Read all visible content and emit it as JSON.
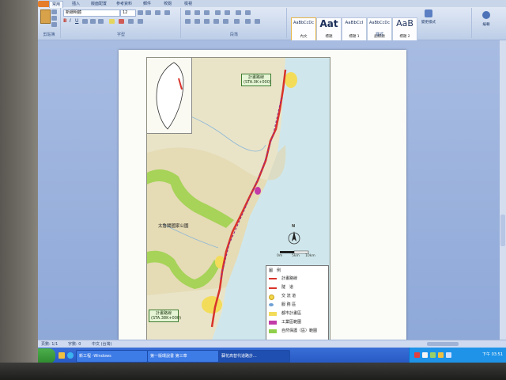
{
  "ribbon": {
    "tabs": [
      "常用",
      "插入",
      "版面配置",
      "參考資料",
      "郵件",
      "校閱",
      "檢視"
    ],
    "font_name": "新細明體",
    "font_size": "12",
    "groups": [
      "剪貼簿",
      "字型",
      "段落",
      "樣式"
    ],
    "styles": [
      {
        "sample": "AaBbCcDc",
        "name": "內文"
      },
      {
        "sample": "Aat",
        "name": "標題"
      },
      {
        "sample": "AaBbCcI",
        "name": "標題 1"
      },
      {
        "sample": "AaBbCcDc",
        "name": "副標題"
      },
      {
        "sample": "AaB",
        "name": "標題 2"
      }
    ],
    "change_styles_label": "變更樣式",
    "edit_label": "編輯"
  },
  "map": {
    "plan_label_top": "計畫路線",
    "plan_sub_top": "(STA.0K+000)",
    "plan_label_bottom": "計畫路線",
    "plan_sub_bottom": "(STA.38K+000)",
    "park_label": "太魯閣國家公園",
    "north_label": "N",
    "scale_labels": [
      "0m",
      "5km",
      "10km"
    ],
    "legend_title": "圖　例",
    "legend_items": [
      {
        "label": "計畫路線",
        "color": "#d9332b"
      },
      {
        "label": "隧　道",
        "color": "#d9332b"
      },
      {
        "label": "交 流 道",
        "color": "#f2d64b"
      },
      {
        "label": "服 務 區",
        "color": "#6ea0d6"
      },
      {
        "label": "都市計畫區",
        "color": "#f3dc5a"
      },
      {
        "label": "工業區範圍",
        "color": "#c23ba8"
      },
      {
        "label": "自然保護（區）範圍",
        "color": "#8fcf4a"
      }
    ]
  },
  "statusbar": {
    "page": "頁數: 1/1",
    "words": "字數: 0",
    "lang": "中文 (台灣)"
  },
  "taskbar": {
    "items": [
      "新工程 -Windows",
      "第一版環說書 第三章",
      "蘇花高替代道路計..."
    ],
    "clock": "下午 03:51"
  }
}
